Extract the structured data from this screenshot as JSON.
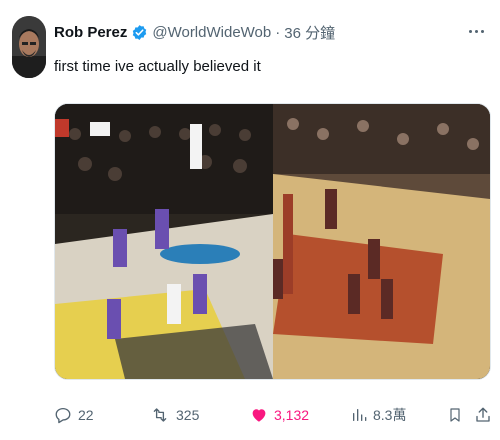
{
  "tweet": {
    "author_name": "Rob Perez",
    "handle": "@WorldWideWob",
    "separator": "·",
    "time": "36 分鐘",
    "text": "first time ive actually believed it"
  },
  "actions": {
    "replies": "22",
    "retweets": "325",
    "likes": "3,132",
    "views": "8.3萬"
  },
  "colors": {
    "verified": "#1d9bf0",
    "like_active": "#f91880",
    "secondary_text": "#536471"
  },
  "icons": [
    "verified-badge-icon",
    "more-icon",
    "reply-icon",
    "retweet-icon",
    "heart-icon",
    "views-icon",
    "bookmark-icon",
    "share-icon"
  ]
}
